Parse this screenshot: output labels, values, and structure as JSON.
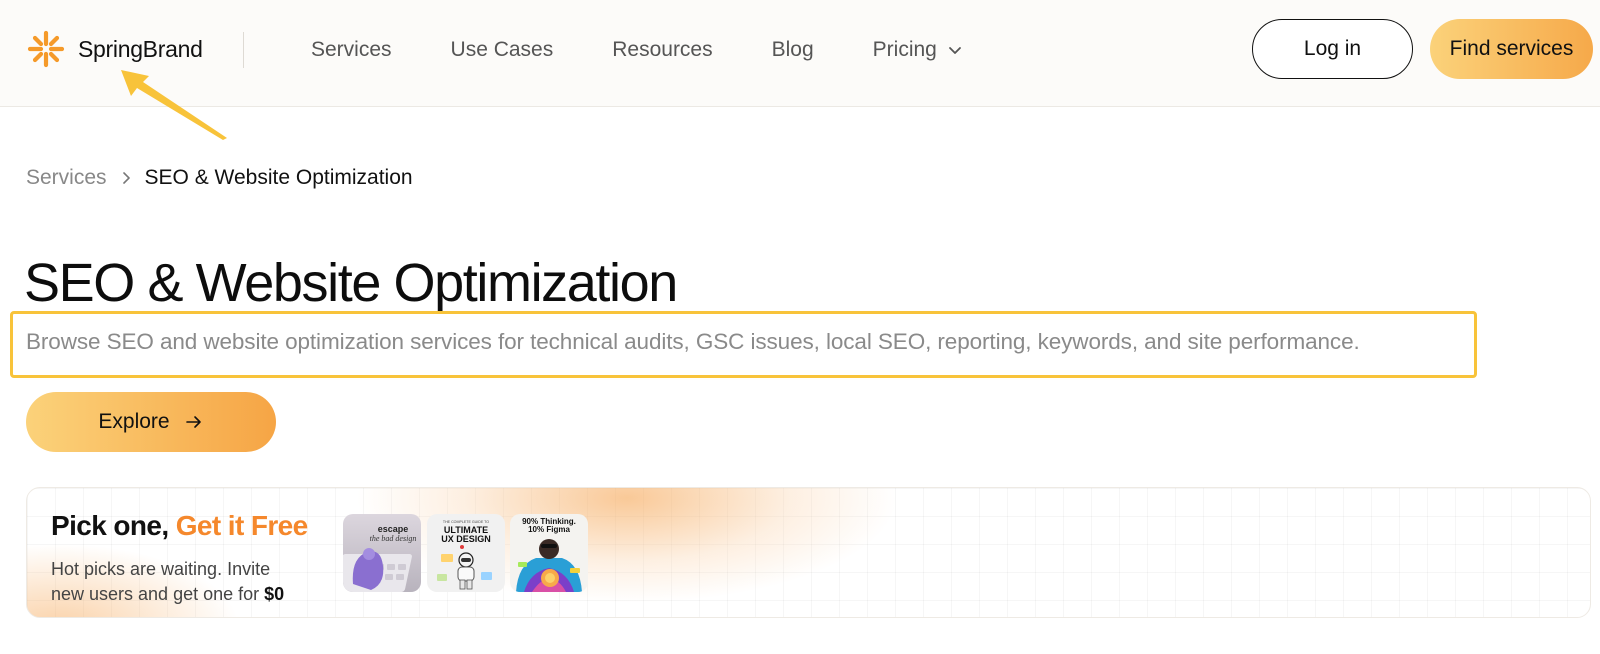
{
  "brand": {
    "name": "SpringBrand",
    "icon": "spring-logo-icon",
    "color": "#f59a2a"
  },
  "nav": {
    "items": [
      {
        "label": "Services"
      },
      {
        "label": "Use Cases"
      },
      {
        "label": "Resources"
      },
      {
        "label": "Blog"
      },
      {
        "label": "Pricing",
        "icon": "chevron-down-icon"
      }
    ]
  },
  "header_actions": {
    "login_label": "Log in",
    "find_label": "Find services"
  },
  "breadcrumb": {
    "parent": "Services",
    "current": "SEO & Website Optimization"
  },
  "hero": {
    "title": "SEO & Website Optimization",
    "subtitle": "Browse SEO and website optimization services for technical audits, GSC issues, local SEO, reporting, keywords, and site performance.",
    "explore_label": "Explore"
  },
  "promo": {
    "title_main": "Pick one, ",
    "title_accent": "Get it Free",
    "desc_main": "Hot picks are waiting. Invite new users and get one for ",
    "desc_price": "$0",
    "thumbs": [
      {
        "line1": "escape",
        "line2": "the bad design"
      },
      {
        "small": "THE COMPLETE GUIDE TO",
        "line1": "ULTIMATE",
        "line2": "UX DESIGN"
      },
      {
        "line1": "90% Thinking.",
        "line2": "10% Figma"
      }
    ]
  },
  "colors": {
    "accent": "#f5882c",
    "button_gradient_start": "#fbd27a",
    "button_gradient_end": "#f6a545",
    "highlight": "#f8c33a"
  }
}
